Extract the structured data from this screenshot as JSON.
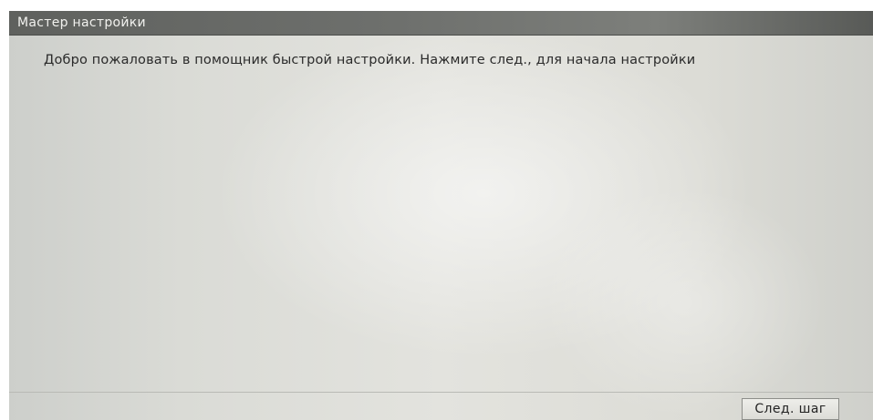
{
  "window": {
    "title": "Мастер настройки"
  },
  "main": {
    "welcome_text": "Добро пожаловать в помощник быстрой настройки. Нажмите след., для начала настройки"
  },
  "footer": {
    "next_label": "След. шаг"
  },
  "colors": {
    "titlebar": "#6e706d",
    "title_text": "#f1f1ee",
    "content_background": "#e3e3de",
    "body_text": "#2a2a2a"
  }
}
